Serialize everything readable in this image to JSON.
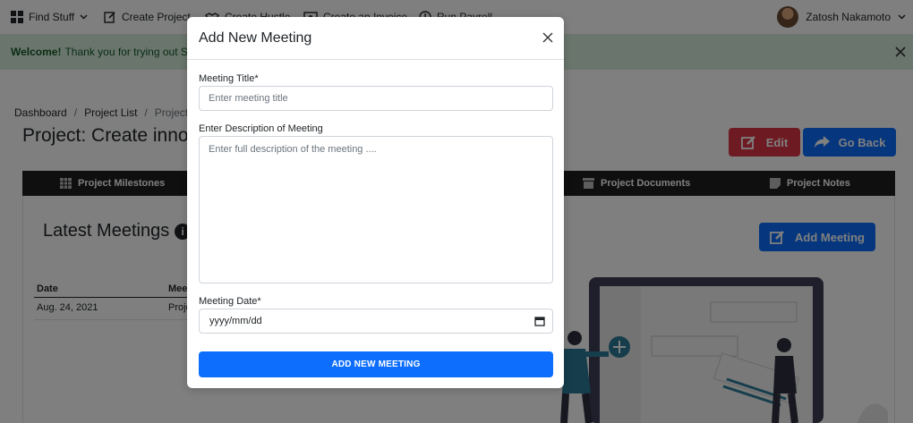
{
  "nav": {
    "find_stuff": "Find Stuff",
    "create_project": "Create Project",
    "create_hustle": "Create Hustle",
    "create_invoice": "Create an Invoice",
    "run_payroll": "Run Payroll",
    "user_name": "Zatosh Nakamoto"
  },
  "alert": {
    "strong": "Welcome!",
    "text": "Thank you for trying out Skhok"
  },
  "breadcrumb": {
    "dashboard": "Dashboard",
    "project_list": "Project List",
    "current": "Project Deta",
    "sep": "/"
  },
  "page": {
    "title": "Project: Create innov",
    "edit_label": "Edit",
    "back_label": "Go Back"
  },
  "tabs": {
    "milestones": "Project Milestones",
    "documents": "Project Documents",
    "notes": "Project Notes"
  },
  "meetings": {
    "heading": "Latest Meetings",
    "info": "i",
    "add_label": "Add Meeting",
    "columns": [
      "Date",
      "Mee"
    ],
    "rows": [
      {
        "date": "Aug. 24, 2021",
        "name": "Proje"
      }
    ]
  },
  "modal": {
    "title": "Add New Meeting",
    "title_label": "Meeting Title*",
    "title_placeholder": "Enter meeting title",
    "description_label": "Enter Description of Meeting",
    "description_placeholder": "Enter full description of the meeting ....",
    "date_label": "Meeting Date*",
    "date_placeholder": "yyyy/mm/dd",
    "submit_label": "ADD NEW MEETING"
  },
  "colors": {
    "primary": "#0d6efd",
    "danger": "#dc3545",
    "alert_bg": "#d4edda",
    "illustration_teal": "#2b7a99"
  }
}
